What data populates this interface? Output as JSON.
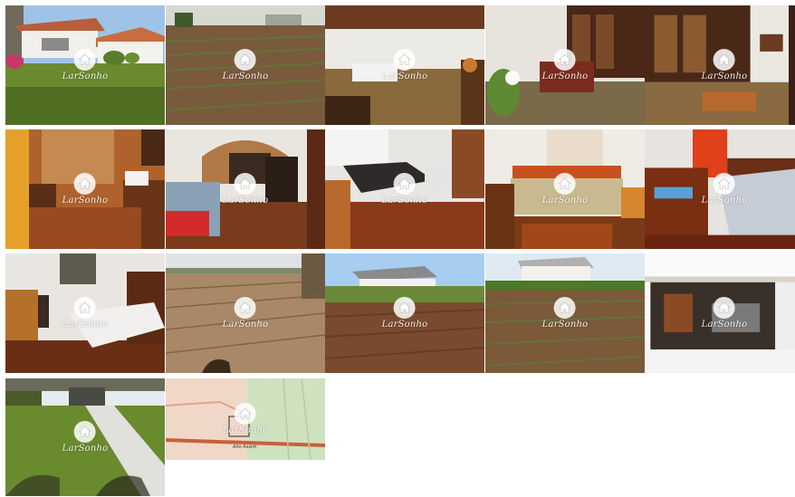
{
  "gallery": {
    "watermark_text": "LarSonho",
    "watermark_icon": "house-icon",
    "photos": [
      {
        "name": "house-front-photo"
      },
      {
        "name": "ploughed-field-photo"
      },
      {
        "name": "dining-room-photo"
      },
      {
        "name": "living-room-photo"
      },
      {
        "name": "hall-staircase-photo"
      },
      {
        "name": "kitchen-photo"
      },
      {
        "name": "lounge-photo"
      },
      {
        "name": "bedroom-1-photo"
      },
      {
        "name": "bedroom-2-photo"
      },
      {
        "name": "bedroom-3-photo"
      },
      {
        "name": "single-bedroom-photo"
      },
      {
        "name": "dry-field-photo"
      },
      {
        "name": "field-with-house-photo"
      },
      {
        "name": "farmland-photo"
      },
      {
        "name": "garage-photo"
      },
      {
        "name": "garden-path-photo"
      },
      {
        "name": "location-map-photo"
      }
    ],
    "map_label": "Alto Assim"
  }
}
